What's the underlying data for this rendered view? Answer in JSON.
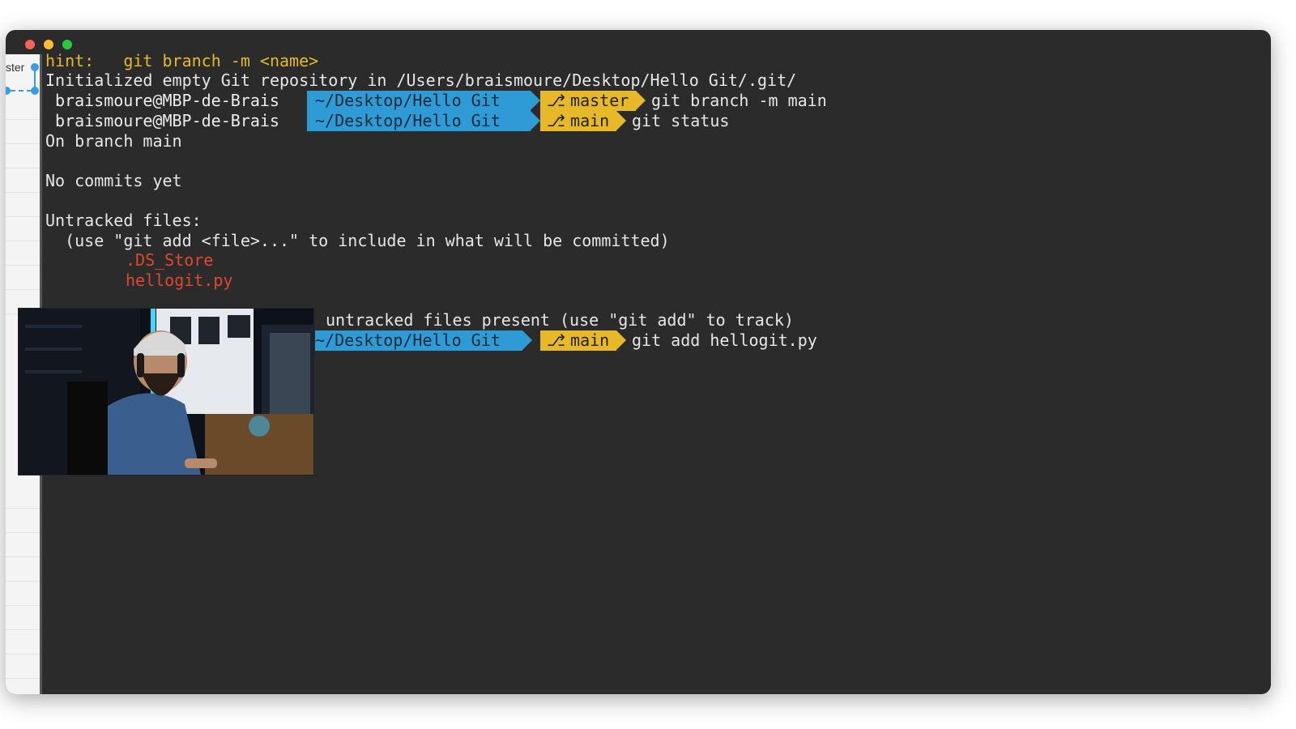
{
  "window": {
    "sidebar_label": "ster"
  },
  "terminal": {
    "hint_line": "hint:   git branch -m <name>",
    "init_line": "Initialized empty Git repository in /Users/braismoure/Desktop/Hello Git/.git/",
    "prompts": [
      {
        "user": "braismoure@MBP-de-Brais",
        "path": "~/Desktop/Hello Git",
        "branch": "master",
        "command": "git branch -m main"
      },
      {
        "user": "braismoure@MBP-de-Brais",
        "path": "~/Desktop/Hello Git",
        "branch": "main",
        "command": "git status"
      },
      {
        "user": "",
        "path": "~/Desktop/Hello Git",
        "branch": "main",
        "command": "git add hellogit.py"
      }
    ],
    "status_lines": {
      "on_branch": "On branch main",
      "no_commits": "No commits yet",
      "untracked_header": "Untracked files:",
      "untracked_hint": "  (use \"git add <file>...\" to include in what will be committed)",
      "files": [
        ".DS_Store",
        "hellogit.py"
      ],
      "nothing_added": "nothing added to commit but untracked files present (use \"git add\" to track)",
      "nothing_added_visible": "untracked files present (use \"git add\" to track)"
    }
  },
  "colors": {
    "path_bg": "#2e9ad6",
    "branch_bg": "#e7b928",
    "file_red": "#e0472e",
    "hint_yellow": "#e7b928"
  }
}
